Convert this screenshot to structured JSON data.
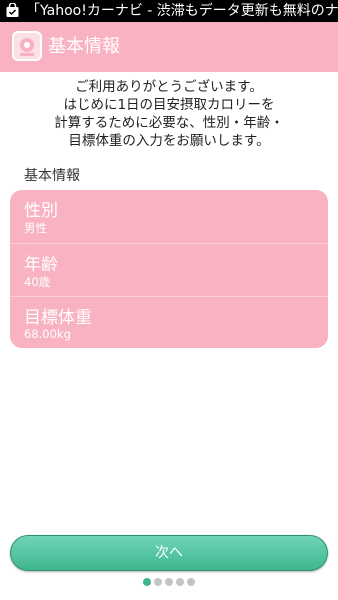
{
  "status_bar": {
    "notification_text": "「Yahoo!カーナビ - 渋滞もデータ更新も無料のナ",
    "icon": "shopping-bag-icon"
  },
  "app_bar": {
    "title": "基本情報",
    "icon": "app-logo-icon",
    "color": "#f9b2c2"
  },
  "intro_lines": [
    "ご利用ありがとうございます。",
    "はじめに1日の目安摂取カロリーを",
    "計算するために必要な、性別・年齢・",
    "目標体重の入力をお願いします。"
  ],
  "section_label": "基本情報",
  "fields": [
    {
      "label": "性別",
      "value": "男性"
    },
    {
      "label": "年齢",
      "value": "40歳"
    },
    {
      "label": "目標体重",
      "value": "68.00kg"
    }
  ],
  "next_button": {
    "label": "次へ",
    "color": "#3fb690"
  },
  "pager": {
    "total": 5,
    "current": 1
  }
}
